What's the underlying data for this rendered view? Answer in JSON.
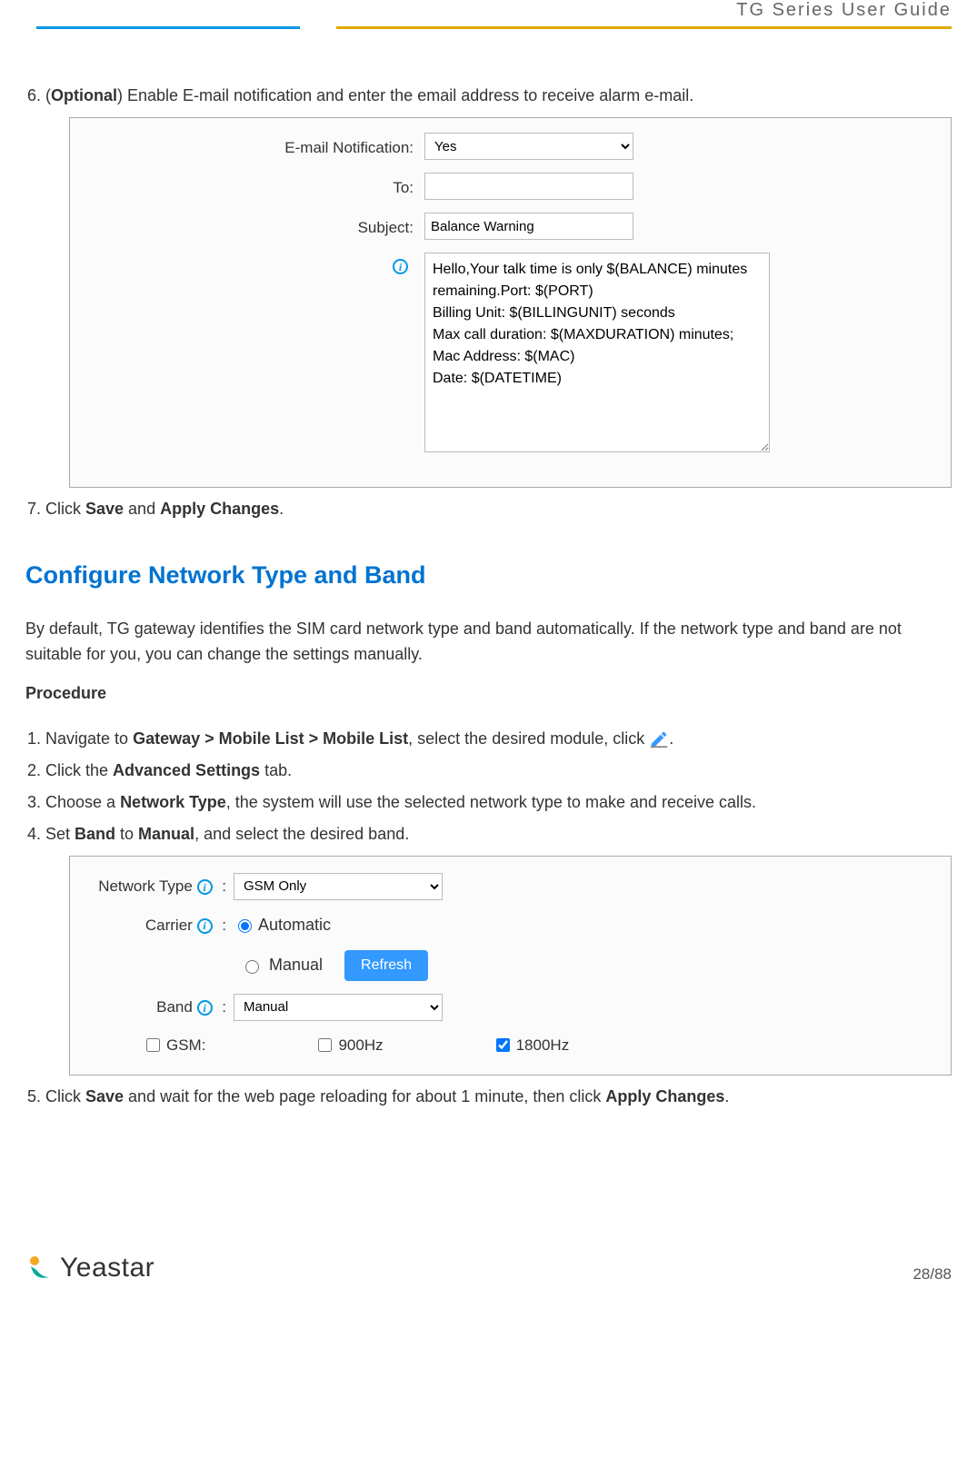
{
  "header": {
    "title": "TG  Series  User  Guide"
  },
  "step6": {
    "num": "6.",
    "prefix": "(",
    "optional": "Optional",
    "suffix": ") Enable E-mail notification and enter the email address to receive alarm e-mail."
  },
  "email_form": {
    "label_notification": "E-mail Notification:",
    "value_notification": "Yes",
    "label_to": "To:",
    "value_to": "",
    "label_subject": "Subject:",
    "value_subject": "Balance Warning",
    "body": "Hello,Your talk time is only $(BALANCE) minutes remaining.Port: $(PORT)\nBilling Unit: $(BILLINGUNIT) seconds\nMax call duration: $(MAXDURATION) minutes;\nMac Address: $(MAC)\nDate: $(DATETIME)"
  },
  "step7": {
    "num": "7.",
    "t1": "Click ",
    "b1": "Save",
    "t2": " and ",
    "b2": "Apply Changes",
    "t3": "."
  },
  "section_title": "Configure Network Type and Band",
  "intro": "By default, TG gateway identifies the SIM card network type and band automatically. If the network type and band are not suitable for you, you can change the settings manually.",
  "procedure": "Procedure",
  "p1": {
    "num": "1.",
    "t1": "Navigate to ",
    "b1": "Gateway > Mobile List > Mobile List",
    "t2": ", select the desired module, click ",
    "t3": "."
  },
  "p2": {
    "num": "2.",
    "t1": "Click the ",
    "b1": "Advanced Settings",
    "t2": " tab."
  },
  "p3": {
    "num": "3.",
    "t1": "Choose a ",
    "b1": "Network Type",
    "t2": ", the system will use the selected network type to make and receive calls."
  },
  "p4": {
    "num": "4.",
    "t1": "Set ",
    "b1": "Band",
    "t2": " to ",
    "b2": "Manual",
    "t3": ", and select the desired band."
  },
  "net_form": {
    "label_nettype": "Network Type",
    "value_nettype": "GSM Only",
    "label_carrier": "Carrier",
    "carrier_auto": "Automatic",
    "carrier_manual": "Manual",
    "refresh": "Refresh",
    "label_band": "Band",
    "value_band": "Manual",
    "gsm": "GSM:",
    "hz900": "900Hz",
    "hz1800": "1800Hz"
  },
  "p5": {
    "num": "5.",
    "t1": "Click ",
    "b1": "Save",
    "t2": " and wait for the web page reloading for about 1 minute, then click ",
    "b2": "Apply Changes",
    "t3": "."
  },
  "footer": {
    "logo": "Yeastar",
    "page": "28/88"
  }
}
